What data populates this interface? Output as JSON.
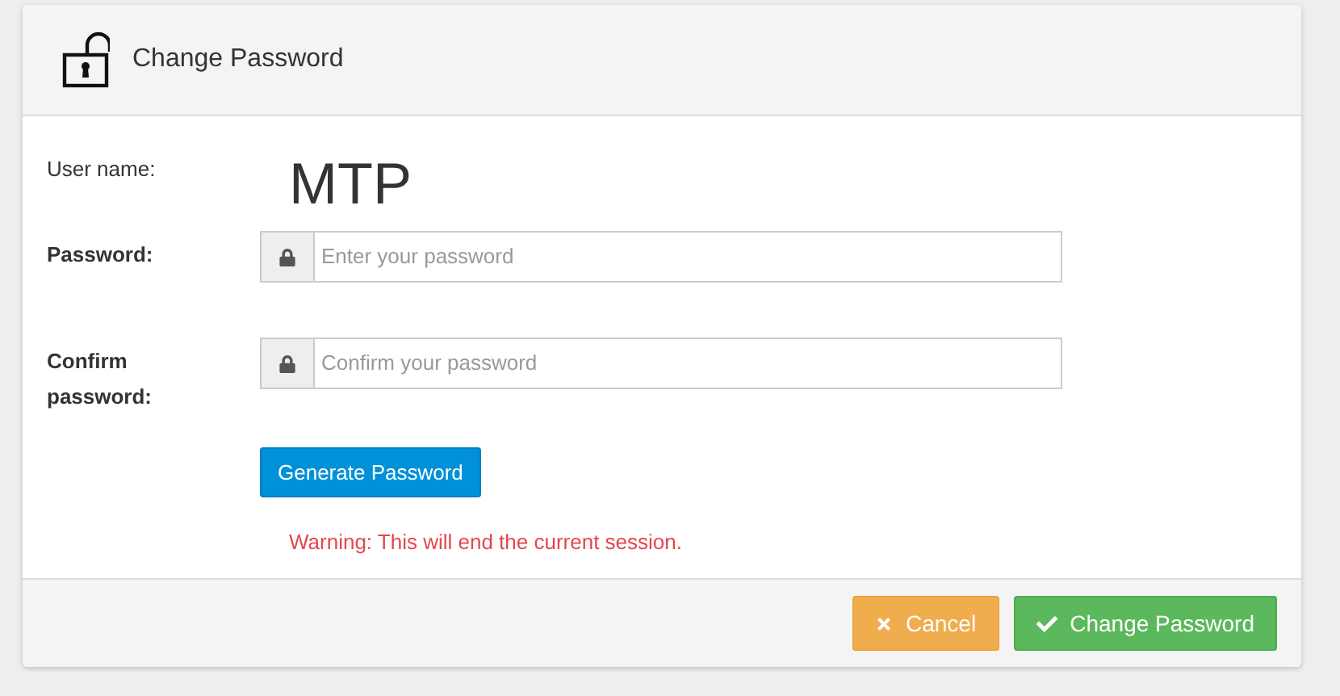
{
  "dialog": {
    "title": "Change Password"
  },
  "user_name": {
    "label": "User name:",
    "value": "MTP"
  },
  "fields": [
    {
      "label": "Password:",
      "placeholder": "Enter your password"
    },
    {
      "label": "Confirm password:",
      "placeholder": "Confirm your password"
    }
  ],
  "generate_button": "Generate Password",
  "warning": "Warning: This will end the current session.",
  "buttons": [
    {
      "kind": "cancel",
      "label": "Cancel"
    },
    {
      "kind": "submit",
      "label": "Change Password"
    }
  ]
}
